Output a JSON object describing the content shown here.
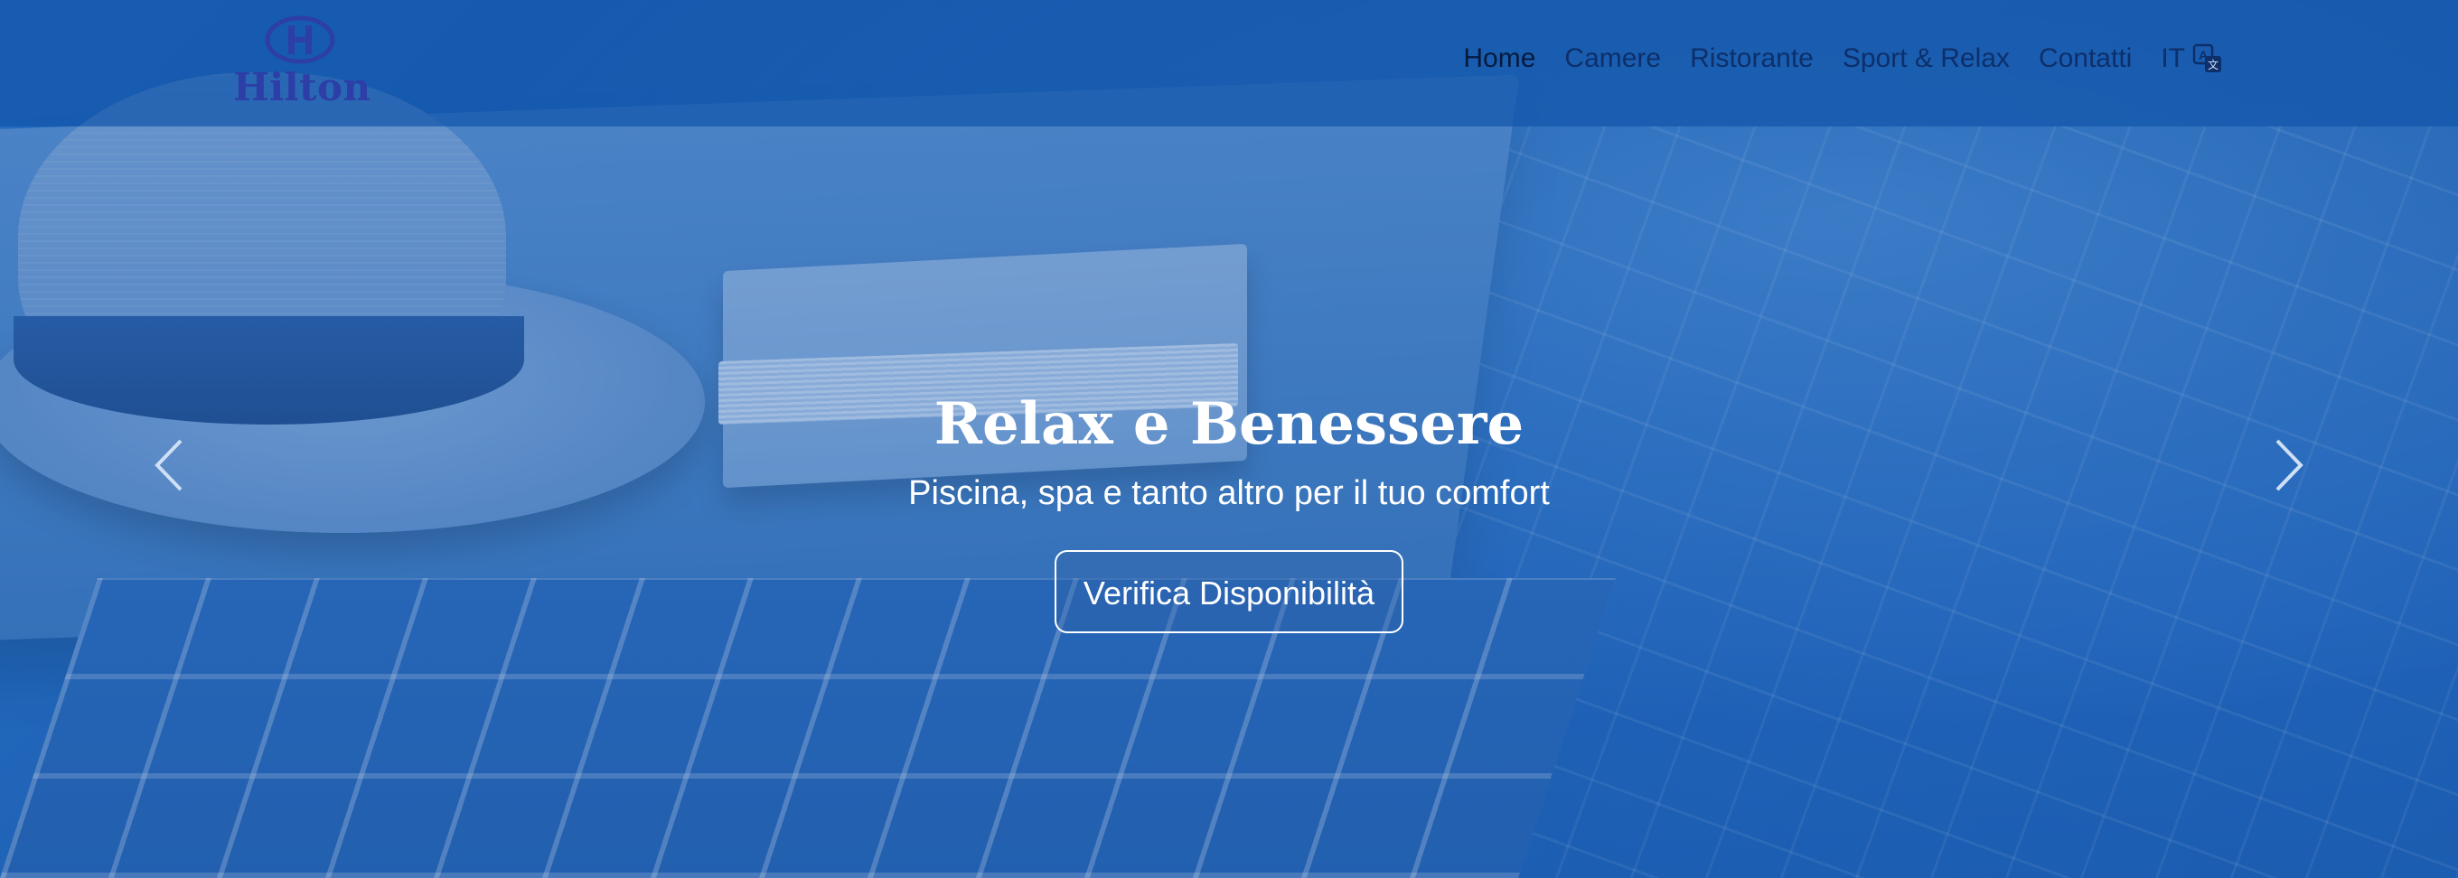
{
  "brand": {
    "name": "Hilton",
    "logo_color": "#2d3ea6"
  },
  "navbar": {
    "items": [
      {
        "label": "Home",
        "active": true
      },
      {
        "label": "Camere",
        "active": false
      },
      {
        "label": "Ristorante",
        "active": false
      },
      {
        "label": "Sport & Relax",
        "active": false
      },
      {
        "label": "Contatti",
        "active": false
      }
    ],
    "language": {
      "label": "IT",
      "icon": "translate-icon"
    }
  },
  "hero": {
    "title": "Relax e Benessere",
    "subtitle": "Piscina, spa e tanto altro per il tuo comfort",
    "cta_label": "Verifica Disponibilità",
    "controls": {
      "prev_icon": "chevron-left-icon",
      "next_icon": "chevron-right-icon"
    }
  },
  "colors": {
    "overlay": "#1456aa",
    "nav_text": "#0d2f6a",
    "caption_text": "#ffffff"
  }
}
